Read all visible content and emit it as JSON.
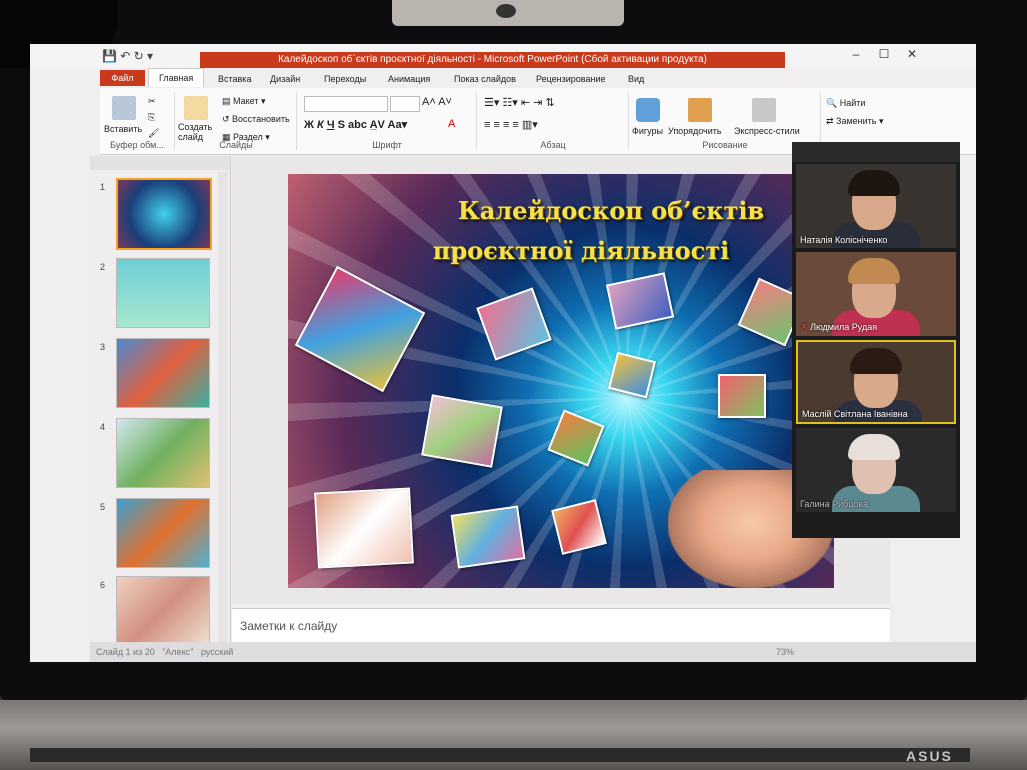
{
  "powerpoint": {
    "window_title": "Калейдоскоп об`єктів проєктної діяльності - Microsoft PowerPoint (Сбой активации продукта)",
    "tabs": [
      "Файл",
      "Главная",
      "Вставка",
      "Дизайн",
      "Переходы",
      "Анимация",
      "Показ слайдов",
      "Рецензирование",
      "Вид"
    ],
    "ribbon": {
      "paste": "Вставить",
      "clipboard_group": "Буфер обм...",
      "new_slide": "Создать слайд",
      "layout": "Макет",
      "reset": "Восстановить",
      "section": "Раздел",
      "slides_group": "Слайды",
      "font_group": "Шрифт",
      "paragraph_group": "Абзац",
      "shapes": "Фигуры",
      "arrange": "Упорядочить",
      "quick_styles": "Экспресс-стили",
      "drawing_group": "Рисование",
      "find": "Найти",
      "replace": "Заменить"
    },
    "slide_numbers": [
      "1",
      "2",
      "3",
      "4",
      "5",
      "6"
    ],
    "slide": {
      "title_line1": "Калейдоскоп об’єктів",
      "title_line2": "проєктної діяльності"
    },
    "notes_placeholder": "Заметки к слайду",
    "status": {
      "slide_counter": "Слайд 1 из 20",
      "theme": "\"Алекс\"",
      "language": "русский",
      "zoom": "73%"
    }
  },
  "video_call": {
    "participants": [
      {
        "name": "Наталія Колісніченко",
        "muted": false
      },
      {
        "name": "Людмила Рудая",
        "muted": true
      },
      {
        "name": "Маслій Світлана Іванівна",
        "muted": false
      },
      {
        "name": "Галина Рибцова",
        "muted": false
      }
    ]
  },
  "laptop_brand": "ASUS"
}
